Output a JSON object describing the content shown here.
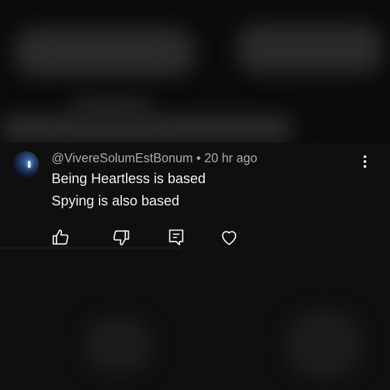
{
  "comment": {
    "author": "@VivereSolumEstBonum",
    "separator": "•",
    "timestamp": "20 hr ago",
    "lines": [
      "Being Heartless is based",
      "Spying is also based"
    ]
  },
  "icons": {
    "more": "more-vert-icon",
    "like": "thumbs-up-icon",
    "dislike": "thumbs-down-icon",
    "reply": "comment-icon",
    "heart": "heart-icon"
  },
  "colors": {
    "background": "#0f0f0f",
    "text_primary": "#f1f1f1",
    "text_secondary": "#aaaaaa"
  }
}
